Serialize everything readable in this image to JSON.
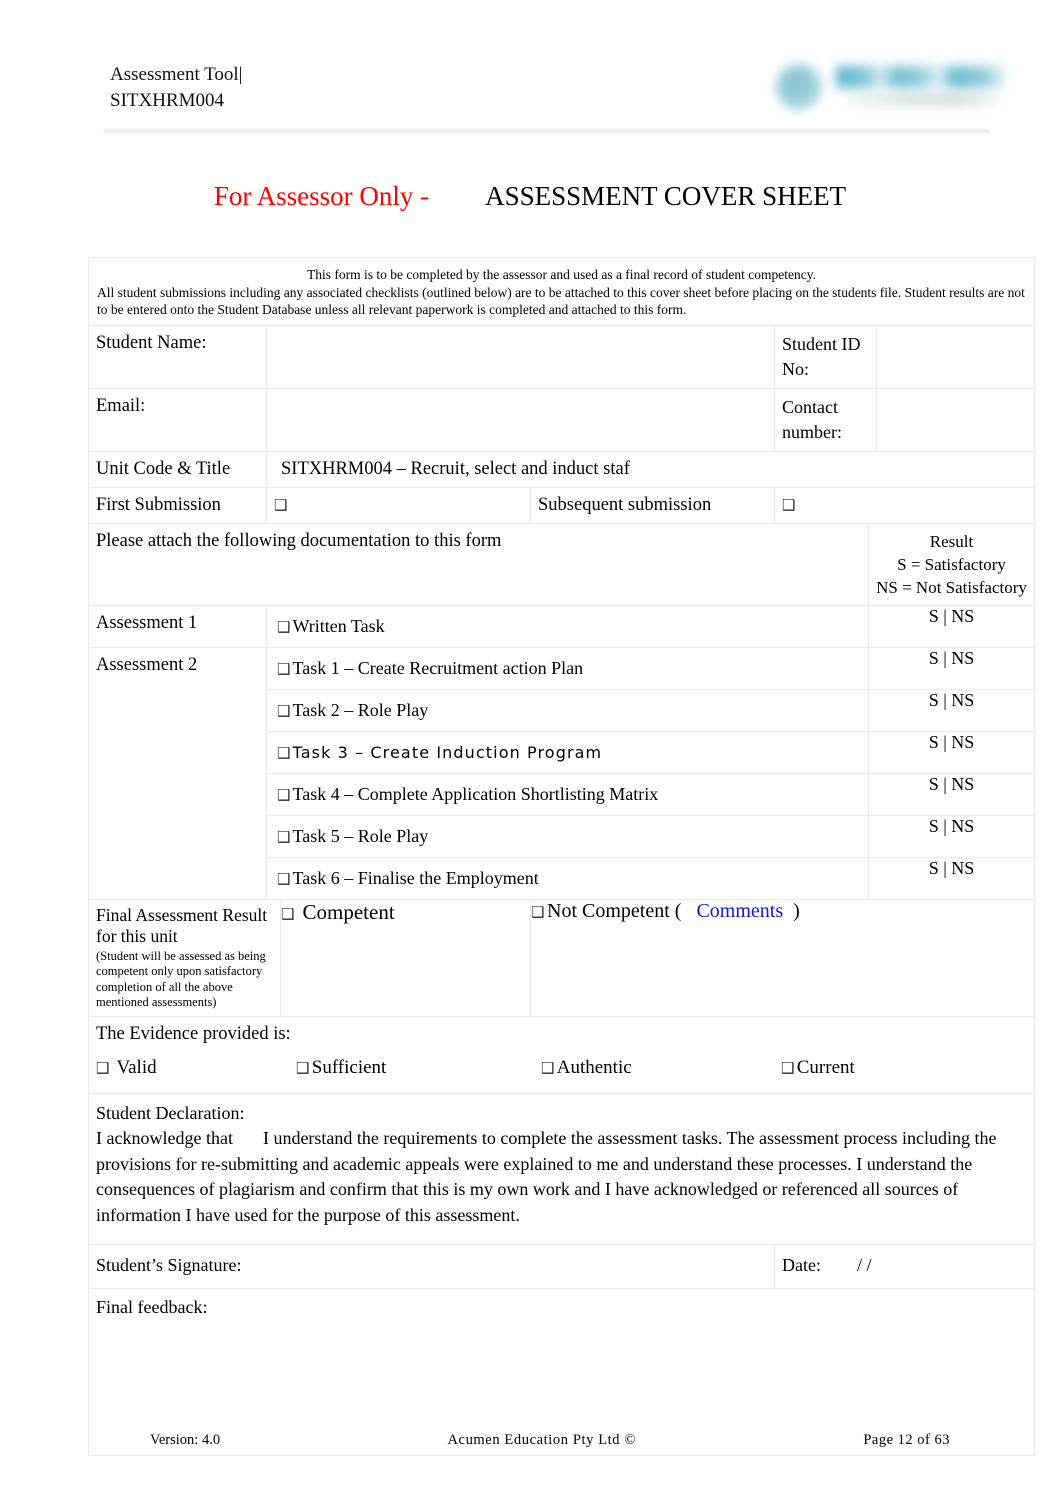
{
  "header": {
    "doc_title": "Assessment Tool|\nSITXHRM004",
    "logo_name": "acumen-education-logo"
  },
  "title": {
    "red_part": "For Assessor Only -",
    "black_part": "ASSESSMENT COVER SHEET"
  },
  "intro": {
    "line1": "This form is to be completed by the assessor and used as a final record of student competency.",
    "rest": "All student submissions including any associated checklists (outlined below) are to be attached to this cover sheet before placing on the students file. Student results are not to be entered onto the Student Database unless all relevant paperwork is completed and attached to this form."
  },
  "fields": {
    "student_name_label": "Student Name:",
    "student_name_value": "",
    "student_id_label": "Student ID No:",
    "student_id_value": "",
    "email_label": "Email:",
    "email_value": "",
    "contact_label": "Contact number:",
    "contact_value": "",
    "unit_code_label": "Unit Code & Title",
    "unit_code_value": "SITXHRM004 – Recruit, select and induct staf",
    "first_submission_label": "First Submission",
    "subsequent_submission_label": "Subsequent  submission"
  },
  "result_header": {
    "line1": "Result",
    "line2": "S = Satisfactory",
    "line3": "NS = Not Satisfactory"
  },
  "attach_note": "Please attach the following documentation to this form",
  "assessments": {
    "a1_label": "Assessment 1",
    "a1_item": "Written Task",
    "a1_result": "S | NS",
    "a2_label": "Assessment 2",
    "tasks": [
      {
        "text": "Task 1 – Create Recruitment action Plan",
        "result": "S | NS"
      },
      {
        "text": "Task 2 – Role Play",
        "result": "S | NS"
      },
      {
        "text": "Task 3 – Create Induction Program",
        "result": "S | NS"
      },
      {
        "text": "Task 4 – Complete Application Shortlisting Matrix",
        "result": "S | NS"
      },
      {
        "text": "Task 5 – Role Play",
        "result": "S | NS"
      },
      {
        "text": "Task 6 – Finalise the Employment",
        "result": "S | NS"
      }
    ]
  },
  "final_result": {
    "label": "Final Assessment Result for this unit",
    "note": "(Student will be assessed as being competent only upon satisfactory completion of all the above mentioned assessments)",
    "competent": "Competent",
    "not_competent_pre": "Not  Competent  (",
    "comments": "Comments",
    "not_competent_post": ")"
  },
  "evidence": {
    "heading": "The Evidence provided is:",
    "items": [
      "Valid",
      "Sufficient",
      "Authentic",
      "Current"
    ]
  },
  "declaration": {
    "heading": "Student Declaration:",
    "body_a": "I acknowledge that",
    "body_b": "I understand the requirements to complete the assessment tasks. The assessment process including the provisions for re-submitting and academic appeals were explained to me and understand these processes. I understand the consequences of plagiarism and confirm that this is my own work and I have acknowledged or referenced all sources of information I have used for the purpose of this assessment.",
    "stray": "I"
  },
  "signature": {
    "label": "Student’s Signature:",
    "date_label": "Date:",
    "date_value": "/            /"
  },
  "feedback": {
    "label": "Final feedback:"
  },
  "footer": {
    "version": "Version: 4.0",
    "org": "Acumen   Education   Pty  Ltd  ©",
    "page": "Page 12   of  63"
  },
  "colors": {
    "accent_red": "#ff0000",
    "link_blue": "#1414e0",
    "logo_teal": "#3fa7c4",
    "border": "#eaeaea"
  }
}
